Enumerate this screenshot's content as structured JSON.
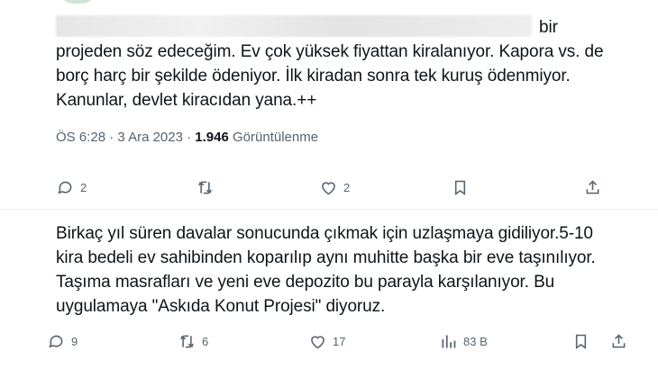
{
  "tweet1": {
    "lines": [
      "bir",
      "projeden söz edeceğim. Ev çok yüksek fiyattan kiralanıyor. Kapora vs. de",
      "borç harç bir şekilde ödeniyor. İlk kiradan sonra tek kuruş ödenmiyor.",
      "Kanunlar, devlet kiracıdan yana.++"
    ],
    "time": "ÖS 6:28",
    "sep": "·",
    "date": "3 Ara 2023",
    "views_count": "1.946",
    "views_label": "Görüntülenme",
    "actions": {
      "replies": "2",
      "reposts": "",
      "likes": "2"
    }
  },
  "tweet2": {
    "lines": [
      "Birkaç yıl süren davalar sonucunda çıkmak için uzlaşmaya gidiliyor.5-10",
      "kira bedeli ev sahibinden koparılıp aynı muhitte başka bir eve taşınılıyor.",
      "Taşıma masrafları ve yeni eve depozito bu parayla karşılanıyor. Bu",
      "uygulamaya \"Askıda Konut Projesi\" diyoruz."
    ],
    "actions": {
      "replies": "9",
      "reposts": "6",
      "likes": "17",
      "views": "83 B"
    }
  },
  "icons": [
    "reply-icon",
    "repost-icon",
    "like-icon",
    "bookmark-icon",
    "share-icon",
    "views-icon"
  ],
  "colors": {
    "text": "#0f1419",
    "secondary": "#536471",
    "divider": "#eff3f4"
  }
}
